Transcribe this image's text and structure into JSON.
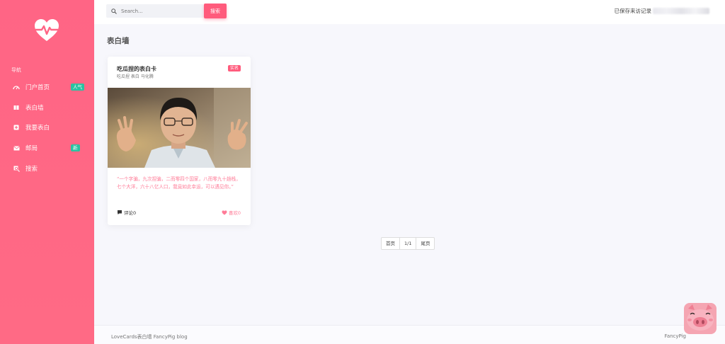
{
  "sidebar": {
    "nav_caption": "导航",
    "items": [
      {
        "label": "门户首页",
        "icon": "dashboard-icon",
        "badge": "人气"
      },
      {
        "label": "表白墙",
        "icon": "book-icon",
        "badge": ""
      },
      {
        "label": "我要表白",
        "icon": "plus-square-icon",
        "badge": ""
      },
      {
        "label": "邮局",
        "icon": "mail-icon",
        "badge": "新"
      },
      {
        "label": "搜索",
        "icon": "search-icon",
        "badge": ""
      }
    ]
  },
  "header": {
    "search_placeholder": "Search...",
    "search_button": "搜索",
    "saved_record": "已保存来访记录"
  },
  "main": {
    "page_title": "表白墙"
  },
  "card": {
    "title": "吃瓜捏的表白卡",
    "subtitle": "吃瓜捏 表白 马化腾",
    "tag": "实名",
    "quote": "“一个字骗，九次捏骗，二而零四个国家，八而零九十趟栈，七个大洋，六十八亿人口，我竟如此幸运，可以遇见你。”",
    "comments": "评论0",
    "likes": "喜欢0"
  },
  "pagination": {
    "first": "首页",
    "current": "1/1",
    "last": "尾页"
  },
  "footer": {
    "left": "LoveCards表白墙 FancyPig blog",
    "right": "FancyPig"
  },
  "colors": {
    "brand": "#ff6585",
    "badge_green": "#2bc2a1",
    "accent_pink": "#ff5b7c"
  }
}
